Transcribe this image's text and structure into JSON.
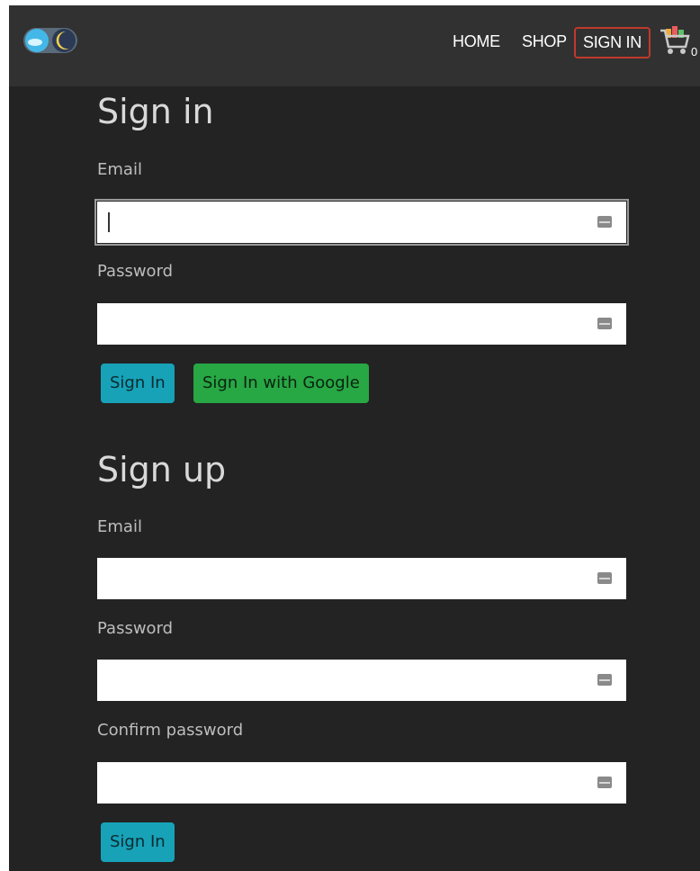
{
  "nav": {
    "home": "HOME",
    "shop": "SHOP",
    "sign_in": "SIGN IN",
    "cart_count": "0"
  },
  "icons": {
    "logo": "theme-toggle-logo-icon",
    "cart": "shopping-cart-icon",
    "field": "credential-key-icon"
  },
  "colors": {
    "background": "#232323",
    "header": "#313131",
    "primary": "#17a2b8",
    "google": "#28a745",
    "active_nav_border": "#c0392b"
  },
  "signin": {
    "title": "Sign in",
    "email_label": "Email",
    "password_label": "Password",
    "submit_label": "Sign In",
    "google_label": "Sign In with Google"
  },
  "signup": {
    "title": "Sign up",
    "email_label": "Email",
    "password_label": "Password",
    "confirm_label": "Confirm password",
    "submit_label": "Sign In"
  }
}
